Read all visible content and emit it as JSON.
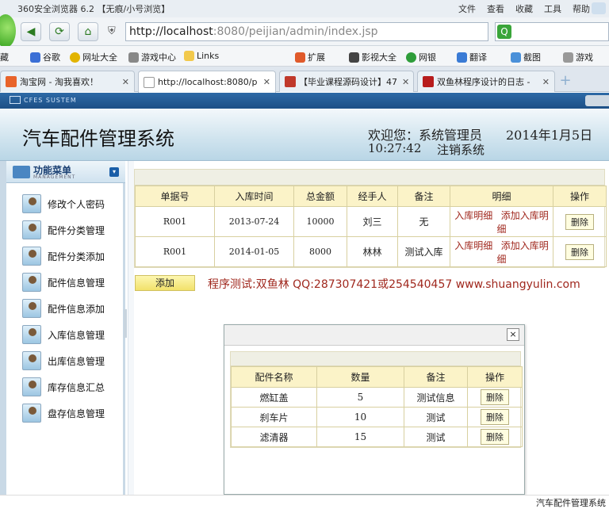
{
  "browser": {
    "title": "360安全浏览器 6.2 【无痕/小号浏览】",
    "menus": [
      "文件",
      "查看",
      "收藏",
      "工具",
      "帮助"
    ],
    "address_host": "http://localhost",
    "address_rest": ":8080/peijian/admin/index.jsp",
    "favorites": [
      "藏",
      "谷歌",
      "网址大全",
      "游戏中心",
      "Links",
      "扩展",
      "影视大全",
      "网银",
      "翻译",
      "截图",
      "游戏"
    ],
    "tabs": [
      {
        "label": "淘宝网 - 淘我喜欢！",
        "color": "#e8632a"
      },
      {
        "label": "http://localhost:8080/p",
        "color": "#ffffff"
      },
      {
        "label": "【毕业课程源码设计】47",
        "color": "#c0392b"
      },
      {
        "label": "双鱼林程序设计的日志 -",
        "color": "#b71c1c"
      }
    ],
    "new_tab": "+"
  },
  "app": {
    "strip_label": "CFES SUSTEM",
    "system_title": "汽车配件管理系统",
    "welcome": "欢迎您：系统管理员",
    "date": "2014年1月5日",
    "time": "10:27:42",
    "logout": "注销系统"
  },
  "sidebar": {
    "title": "功能菜单",
    "subtitle": "MANAGEMENT",
    "toggle": "▾",
    "items": [
      {
        "label": "修改个人密码"
      },
      {
        "label": "配件分类管理"
      },
      {
        "label": "配件分类添加"
      },
      {
        "label": "配件信息管理"
      },
      {
        "label": "配件信息添加"
      },
      {
        "label": "入库信息管理"
      },
      {
        "label": "出库信息管理"
      },
      {
        "label": "库存信息汇总"
      },
      {
        "label": "盘存信息管理"
      }
    ]
  },
  "main_table": {
    "headers": [
      "单据号",
      "入库时间",
      "总金额",
      "经手人",
      "备注",
      "明细",
      "操作"
    ],
    "rows": [
      {
        "id": "R001",
        "time": "2013-07-24",
        "amount": "10000",
        "handler": "刘三",
        "note": "无",
        "detail1": "入库明细",
        "detail2": "添加入库明细",
        "action": "删除"
      },
      {
        "id": "R001",
        "time": "2014-01-05",
        "amount": "8000",
        "handler": "林林",
        "note": "测试入库",
        "detail1": "入库明细",
        "detail2": "添加入库明细",
        "action": "删除"
      }
    ]
  },
  "add_button": "添加",
  "credit": "程序测试:双鱼林 QQ:287307421或254540457 www.shuangyulin.com",
  "dialog": {
    "close": "×",
    "headers": [
      "配件名称",
      "数量",
      "备注",
      "操作"
    ],
    "rows": [
      {
        "name": "燃缸盖",
        "qty": "5",
        "note": "测试信息",
        "action": "删除"
      },
      {
        "name": "刹车片",
        "qty": "10",
        "note": "测试",
        "action": "删除"
      },
      {
        "name": "滤清器",
        "qty": "15",
        "note": "测试",
        "action": "删除"
      }
    ]
  },
  "status": "汽车配件管理系统"
}
